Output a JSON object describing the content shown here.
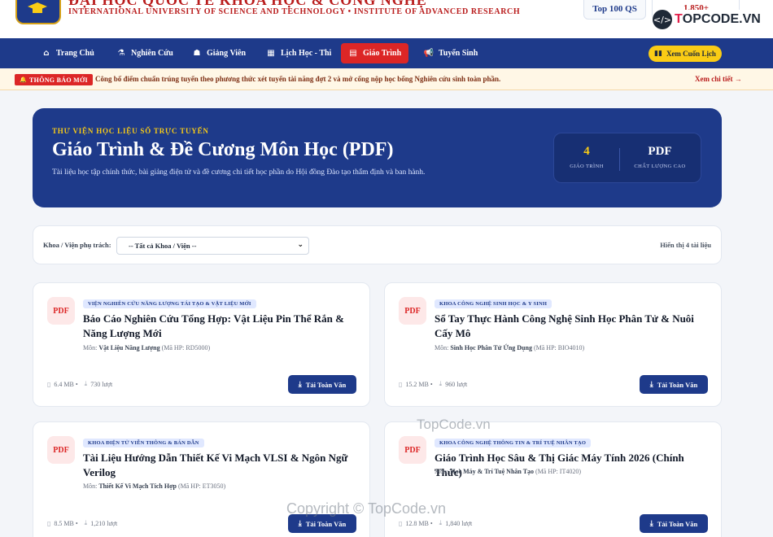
{
  "header": {
    "university_name": "ĐẠI HỌC QUỐC TẾ KHOA HỌC & CÔNG NGHỆ",
    "university_subtitle": "INTERNATIONAL UNIVERSITY OF SCIENCE AND TECHNOLOGY • INSTITUTE OF ADVANCED RESEARCH",
    "rank_badge": "Top 100 QS",
    "count_badge": "1,850+",
    "watermark_logo": "TOPCODE.VN"
  },
  "nav": {
    "items": [
      {
        "label": "Trang Chủ",
        "icon": "home-icon"
      },
      {
        "label": "Nghiên Cứu",
        "icon": "flask-icon"
      },
      {
        "label": "Giảng Viên",
        "icon": "teacher-icon"
      },
      {
        "label": "Lịch Học - Thi",
        "icon": "calendar-icon"
      },
      {
        "label": "Giáo Trình",
        "icon": "pdf-icon",
        "active": true
      },
      {
        "label": "Tuyển Sinh",
        "icon": "megaphone-icon"
      }
    ],
    "cta_label": "Xem Cuốn Lịch"
  },
  "notice": {
    "tag": "THÔNG BÁO MỚI",
    "text": "Công bố điểm chuẩn trúng tuyển theo phương thức xét tuyển tài năng đợt 2 và mở cổng nộp học bổng Nghiên cứu sinh toàn phần.",
    "link": "Xem chi tiết →"
  },
  "hero": {
    "kicker": "THƯ VIỆN HỌC LIỆU SỐ TRỰC TUYẾN",
    "title": "Giáo Trình & Đề Cương Môn Học (PDF)",
    "description": "Tài liệu học tập chính thức, bài giảng điện tử và đề cương chi tiết học phần do Hội đồng Đào tạo thẩm định và ban hành.",
    "stats": [
      {
        "value": "4",
        "label": "GIÁO TRÌNH",
        "color": "#facc15"
      },
      {
        "value": "PDF",
        "label": "CHẤT LƯỢNG CAO",
        "color": "#ffffff"
      }
    ]
  },
  "filter": {
    "label": "Khoa / Viện phụ trách:",
    "selected": "-- Tất cả Khoa / Viện --",
    "count_text": "Hiển thị 4 tài liệu"
  },
  "documents": [
    {
      "badge": "PDF",
      "department": "VIỆN NGHIÊN CỨU NĂNG LƯỢNG TÁI TẠO & VẬT LIỆU MỚI",
      "title": "Báo Cáo Nghiên Cứu Tổng Hợp: Vật Liệu Pin Thể Rắn & Năng Lượng Mới",
      "subject_label": "Môn:",
      "subject": "Vật Liệu Năng Lượng",
      "code": "(Mã HP: RD5000)",
      "size": "6.4 MB •",
      "downloads": "730 lượt",
      "button": "Tải Toàn Văn"
    },
    {
      "badge": "PDF",
      "department": "KHOA CÔNG NGHỆ SINH HỌC & Y SINH",
      "title": "Sổ Tay Thực Hành Công Nghệ Sinh Học Phân Tử & Nuôi Cấy Mô",
      "subject_label": "Môn:",
      "subject": "Sinh Học Phân Tử Ứng Dụng",
      "code": "(Mã HP: BIO4010)",
      "size": "15.2 MB •",
      "downloads": "960 lượt",
      "button": "Tải Toàn Văn"
    },
    {
      "badge": "PDF",
      "department": "KHOA ĐIỆN TỬ VIỄN THÔNG & BÁN DẪN",
      "title": "Tài Liệu Hướng Dẫn Thiết Kế Vi Mạch VLSI & Ngôn Ngữ Verilog",
      "subject_label": "Môn:",
      "subject": "Thiết Kế Vi Mạch Tích Hợp",
      "code": "(Mã HP: ET3050)",
      "size": "8.5 MB •",
      "downloads": "1,210 lượt",
      "button": "Tải Toàn Văn"
    },
    {
      "badge": "PDF",
      "department": "KHOA CÔNG NGHỆ THÔNG TIN & TRÍ TUỆ NHÂN TẠO",
      "title": "Giáo Trình Học Sâu & Thị Giác Máy Tính 2026 (Chính Thức)",
      "subject_label": "Môn:",
      "subject": "Học Máy & Trí Tuệ Nhân Tạo",
      "code": "(Mã HP: IT4020)",
      "size": "12.8 MB •",
      "downloads": "1,840 lượt",
      "button": "Tải Toàn Văn"
    }
  ],
  "watermarks": [
    "TopCode.vn",
    "Copyright © TopCode.vn"
  ]
}
